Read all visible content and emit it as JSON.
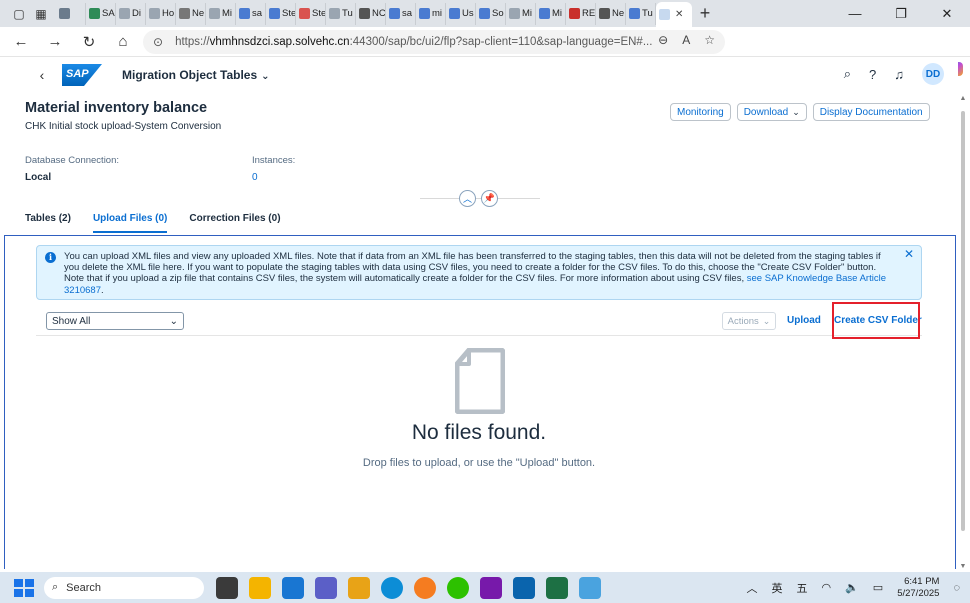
{
  "browser": {
    "tabs": [
      {
        "label": "",
        "color": "#6b7b8c"
      },
      {
        "label": "SA",
        "color": "#2e8b57"
      },
      {
        "label": "Di",
        "color": "#9aa5b1"
      },
      {
        "label": "Ho",
        "color": "#9aa5b1"
      },
      {
        "label": "Ne",
        "color": "#777777"
      },
      {
        "label": "Mi",
        "color": "#9aa5b1"
      },
      {
        "label": "sa",
        "color": "#4a7bd1"
      },
      {
        "label": "Ste",
        "color": "#4a7bd1"
      },
      {
        "label": "Ste",
        "color": "#d9534f"
      },
      {
        "label": "Tu",
        "color": "#9aa5b1"
      },
      {
        "label": "NC",
        "color": "#555555"
      },
      {
        "label": "sa",
        "color": "#4a7bd1"
      },
      {
        "label": "mi",
        "color": "#4a7bd1"
      },
      {
        "label": "Us",
        "color": "#4a7bd1"
      },
      {
        "label": "So",
        "color": "#4a7bd1"
      },
      {
        "label": "Mi",
        "color": "#9aa5b1"
      },
      {
        "label": "Mi",
        "color": "#4a7bd1"
      },
      {
        "label": "RE",
        "color": "#c9302c"
      },
      {
        "label": "Ne",
        "color": "#555555"
      },
      {
        "label": "Tu",
        "color": "#4a7bd1"
      }
    ],
    "active_tab_close": "✕",
    "new_tab": "+",
    "url_prefix": "https://",
    "url_host": "vhmhnsdzci.sap.solvehc.cn",
    "url_rest": ":44300/sap/bc/ui2/flp?sap-client=110&sap-language=EN#..."
  },
  "shell": {
    "logo_text": "SAP",
    "app_title": "Migration Object Tables",
    "avatar": "DD"
  },
  "header": {
    "title": "Material inventory balance",
    "subtitle": "CHK Initial stock upload-System Conversion",
    "actions": {
      "monitoring": "Monitoring",
      "download": "Download",
      "display_documentation": "Display Documentation"
    },
    "database_connection_label": "Database Connection:",
    "database_connection_value": "Local",
    "instances_label": "Instances:",
    "instances_value": "0"
  },
  "tabs": [
    {
      "label": "Tables (2)"
    },
    {
      "label": "Upload Files (0)"
    },
    {
      "label": "Correction Files (0)"
    }
  ],
  "info": {
    "text": "You can upload XML files and view any uploaded XML files. Note that if data from an XML file has been transferred to the staging tables, then this data will not be deleted from the staging tables if you delete the XML file here. If you want to populate the staging tables with data using CSV files, you need to create a folder for the CSV files. To do this, choose the \"Create CSV Folder\" button. Note that if you upload a zip file that contains CSV files, the system will automatically create a folder for the CSV files. For more information about using CSV files, ",
    "link": "see SAP Knowledge Base Article 3210687",
    "suffix": "."
  },
  "toolbar": {
    "filter_value": "Show All",
    "actions_label": "Actions",
    "upload_label": "Upload",
    "create_csv_folder_label": "Create CSV Folder"
  },
  "empty_state": {
    "title": "No files found.",
    "subtitle": "Drop files to upload, or use the \"Upload\" button."
  },
  "taskbar": {
    "search_placeholder": "Search",
    "tray_ime1": "英",
    "tray_ime2": "五",
    "time": "6:41 PM",
    "date": "5/27/2025"
  }
}
